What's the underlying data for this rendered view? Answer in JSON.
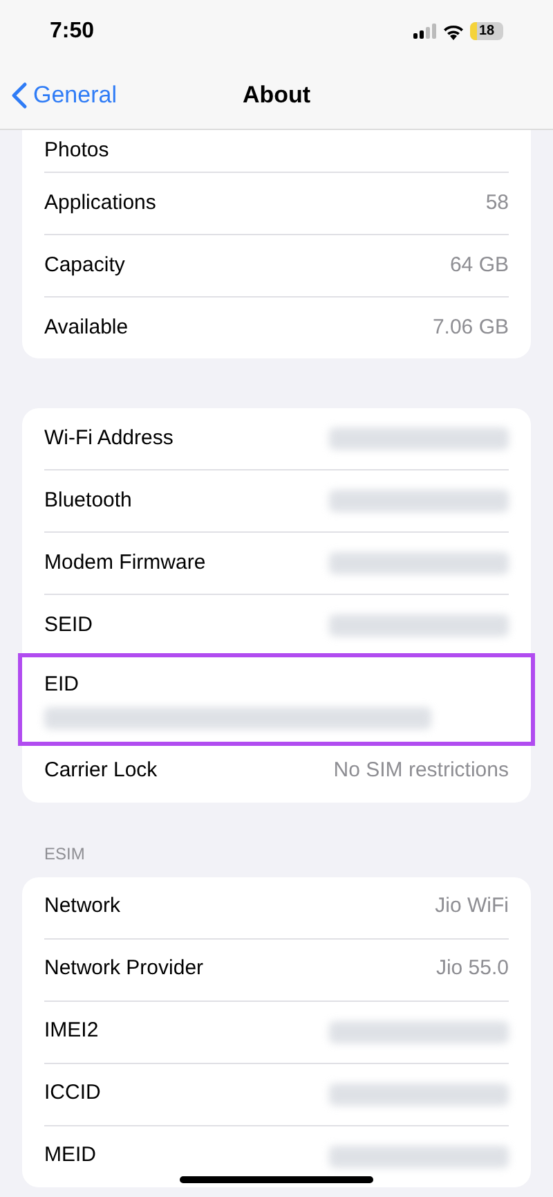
{
  "status_bar": {
    "time": "7:50",
    "battery": "18"
  },
  "nav": {
    "back": "General",
    "title": "About"
  },
  "groups": [
    {
      "rows": [
        {
          "label": "Photos",
          "clipped": true
        },
        {
          "label": "Applications",
          "value": "58"
        },
        {
          "label": "Capacity",
          "value": "64 GB"
        },
        {
          "label": "Available",
          "value": "7.06 GB"
        }
      ]
    },
    {
      "rows": [
        {
          "label": "Wi-Fi Address",
          "redacted": true
        },
        {
          "label": "Bluetooth",
          "redacted": true
        },
        {
          "label": "Modem Firmware",
          "redacted": true
        },
        {
          "label": "SEID",
          "redacted": true
        },
        {
          "label": "EID",
          "redacted": true,
          "stacked": true,
          "highlighted": true
        },
        {
          "label": "Carrier Lock",
          "value": "No SIM restrictions"
        }
      ]
    },
    {
      "header": "ESIM",
      "rows": [
        {
          "label": "Network",
          "value": "Jio WiFi"
        },
        {
          "label": "Network Provider",
          "value": "Jio 55.0"
        },
        {
          "label": "IMEI2",
          "redacted": true
        },
        {
          "label": "ICCID",
          "redacted": true
        },
        {
          "label": "MEID",
          "redacted": true
        }
      ]
    }
  ]
}
